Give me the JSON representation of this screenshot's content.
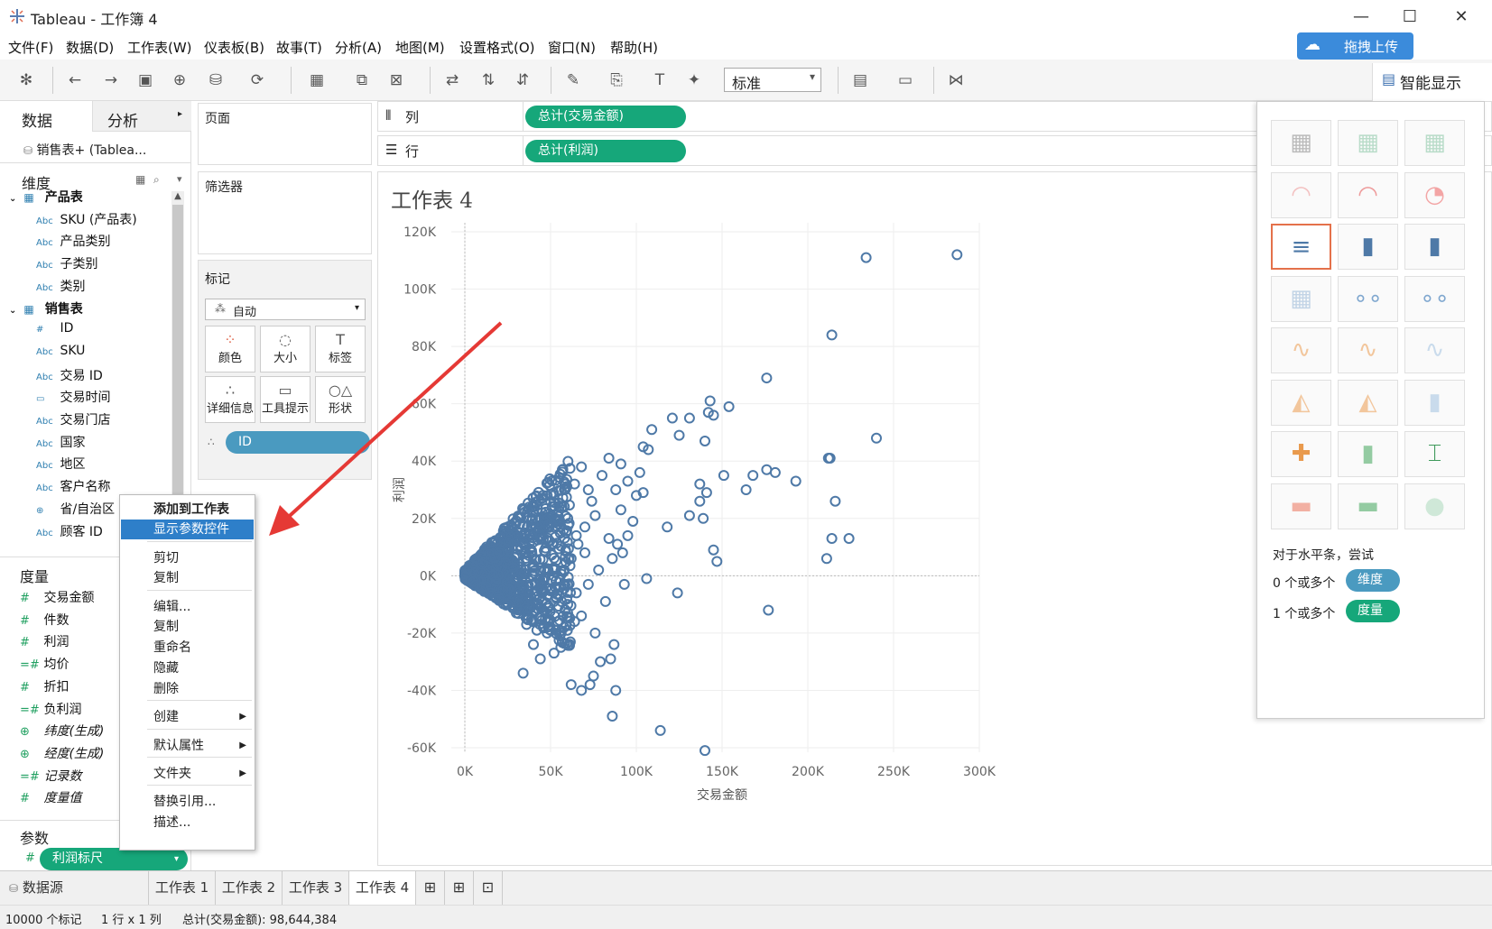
{
  "window": {
    "title": "Tableau - 工作簿 4"
  },
  "menu": [
    "文件(F)",
    "数据(D)",
    "工作表(W)",
    "仪表板(B)",
    "故事(T)",
    "分析(A)",
    "地图(M)",
    "设置格式(O)",
    "窗口(N)",
    "帮助(H)"
  ],
  "upload_button": "拖拽上传",
  "toolbar": {
    "fit_select": "标准",
    "show_me": "智能显示"
  },
  "left_panel": {
    "tabs": [
      "数据",
      "分析"
    ],
    "datasource": "销售表+ (Tablea...",
    "dimensions_header": "维度",
    "tables": [
      {
        "name": "产品表",
        "fields": [
          {
            "type": "Abc",
            "name": "SKU (产品表)"
          },
          {
            "type": "Abc",
            "name": "产品类别"
          },
          {
            "type": "Abc",
            "name": "子类别"
          },
          {
            "type": "Abc",
            "name": "类别"
          }
        ]
      },
      {
        "name": "销售表",
        "fields": [
          {
            "type": "#",
            "name": "ID"
          },
          {
            "type": "Abc",
            "name": "SKU"
          },
          {
            "type": "Abc",
            "name": "交易 ID"
          },
          {
            "type": "date",
            "name": "交易时间"
          },
          {
            "type": "Abc",
            "name": "交易门店"
          },
          {
            "type": "Abc",
            "name": "国家"
          },
          {
            "type": "Abc",
            "name": "地区"
          },
          {
            "type": "Abc",
            "name": "客户名称"
          },
          {
            "type": "geo",
            "name": "省/自治区"
          },
          {
            "type": "Abc",
            "name": "顾客 ID"
          }
        ]
      }
    ],
    "measures_header": "度量",
    "measures": [
      {
        "type": "#",
        "name": "交易金额",
        "italic": false
      },
      {
        "type": "#",
        "name": "件数",
        "italic": false
      },
      {
        "type": "#",
        "name": "利润",
        "italic": false
      },
      {
        "type": "=#",
        "name": "均价",
        "italic": false
      },
      {
        "type": "#",
        "name": "折扣",
        "italic": false
      },
      {
        "type": "=#",
        "name": "负利润",
        "italic": false
      },
      {
        "type": "geo",
        "name": "纬度(生成)",
        "italic": true
      },
      {
        "type": "geo",
        "name": "经度(生成)",
        "italic": true
      },
      {
        "type": "=#",
        "name": "记录数",
        "italic": true
      },
      {
        "type": "#",
        "name": "度量值",
        "italic": true
      }
    ],
    "params_header": "参数",
    "param": "利润标尺"
  },
  "cards": {
    "pages": "页面",
    "filters": "筛选器",
    "marks": "标记",
    "mark_type": "自动",
    "mark_buttons": [
      "颜色",
      "大小",
      "标签",
      "详细信息",
      "工具提示",
      "形状"
    ],
    "detail_pill": "ID"
  },
  "shelves": {
    "columns_label": "列",
    "rows_label": "行",
    "columns_pill": "总计(交易金额)",
    "rows_pill": "总计(利润)"
  },
  "context_menu": {
    "items": [
      {
        "label": "添加到工作表",
        "bold": true,
        "highlight": false,
        "submenu": false
      },
      {
        "label": "显示参数控件",
        "bold": false,
        "highlight": true,
        "submenu": false
      },
      {
        "label": "剪切",
        "bold": false,
        "highlight": false,
        "submenu": false
      },
      {
        "label": "复制",
        "bold": false,
        "highlight": false,
        "submenu": false
      },
      {
        "label": "编辑...",
        "bold": false,
        "highlight": false,
        "submenu": false
      },
      {
        "label": "复制",
        "bold": false,
        "highlight": false,
        "submenu": false
      },
      {
        "label": "重命名",
        "bold": false,
        "highlight": false,
        "submenu": false
      },
      {
        "label": "隐藏",
        "bold": false,
        "highlight": false,
        "submenu": false
      },
      {
        "label": "删除",
        "bold": false,
        "highlight": false,
        "submenu": false
      },
      {
        "label": "创建",
        "bold": false,
        "highlight": false,
        "submenu": true
      },
      {
        "label": "默认属性",
        "bold": false,
        "highlight": false,
        "submenu": true
      },
      {
        "label": "文件夹",
        "bold": false,
        "highlight": false,
        "submenu": true
      },
      {
        "label": "替换引用...",
        "bold": false,
        "highlight": false,
        "submenu": false
      },
      {
        "label": "描述...",
        "bold": false,
        "highlight": false,
        "submenu": false
      }
    ]
  },
  "chart_data": {
    "type": "scatter",
    "title": "工作表 4",
    "xlabel": "交易金额",
    "ylabel": "利润",
    "xlim": [
      0,
      300000
    ],
    "ylim": [
      -60000,
      120000
    ],
    "x_ticks": [
      "0K",
      "50K",
      "100K",
      "150K",
      "200K",
      "250K",
      "300K"
    ],
    "y_ticks": [
      "120K",
      "100K",
      "80K",
      "60K",
      "40K",
      "20K",
      "0K",
      "-20K",
      "-40K",
      "-60K"
    ],
    "marker_color": "#4e79a7",
    "dense_cluster_note_points": "approximate — thousands of overlapping points near origin",
    "points": [
      [
        287000,
        112000
      ],
      [
        234000,
        111000
      ],
      [
        214000,
        84000
      ],
      [
        240000,
        48000
      ],
      [
        176000,
        69000
      ],
      [
        143000,
        61000
      ],
      [
        154000,
        59000
      ],
      [
        142000,
        57000
      ],
      [
        145000,
        56000
      ],
      [
        121000,
        55000
      ],
      [
        131000,
        55000
      ],
      [
        109000,
        51000
      ],
      [
        125000,
        49000
      ],
      [
        140000,
        47000
      ],
      [
        213000,
        41000
      ],
      [
        212000,
        41000
      ],
      [
        176000,
        37000
      ],
      [
        181000,
        36000
      ],
      [
        168000,
        35000
      ],
      [
        193000,
        33000
      ],
      [
        151000,
        35000
      ],
      [
        137000,
        32000
      ],
      [
        141000,
        29000
      ],
      [
        164000,
        30000
      ],
      [
        216000,
        26000
      ],
      [
        137000,
        26000
      ],
      [
        139000,
        20000
      ],
      [
        131000,
        21000
      ],
      [
        224000,
        13000
      ],
      [
        214000,
        13000
      ],
      [
        118000,
        17000
      ],
      [
        145000,
        9000
      ],
      [
        147000,
        5000
      ],
      [
        211000,
        6000
      ],
      [
        177000,
        -12000
      ],
      [
        124000,
        -6000
      ],
      [
        106000,
        -1000
      ],
      [
        93000,
        -3000
      ],
      [
        87000,
        -24000
      ],
      [
        85000,
        -29000
      ],
      [
        79000,
        -30000
      ],
      [
        75000,
        -35000
      ],
      [
        73000,
        -38000
      ],
      [
        62000,
        -38000
      ],
      [
        68000,
        -40000
      ],
      [
        88000,
        -40000
      ],
      [
        86000,
        -49000
      ],
      [
        114000,
        -54000
      ],
      [
        140000,
        -61000
      ],
      [
        34000,
        -34000
      ],
      [
        44000,
        -29000
      ],
      [
        56000,
        -25000
      ],
      [
        98000,
        19000
      ],
      [
        95000,
        14000
      ],
      [
        89000,
        11000
      ],
      [
        84000,
        13000
      ],
      [
        91000,
        23000
      ],
      [
        100000,
        28000
      ],
      [
        104000,
        29000
      ],
      [
        102000,
        36000
      ],
      [
        107000,
        44000
      ],
      [
        104000,
        45000
      ],
      [
        91000,
        39000
      ],
      [
        95000,
        33000
      ],
      [
        88000,
        30000
      ],
      [
        80000,
        35000
      ],
      [
        84000,
        41000
      ],
      [
        74000,
        26000
      ],
      [
        76000,
        21000
      ],
      [
        70000,
        17000
      ],
      [
        66000,
        11000
      ],
      [
        62000,
        6000
      ],
      [
        58000,
        2000
      ],
      [
        55000,
        -4000
      ],
      [
        52000,
        -9000
      ],
      [
        47000,
        -15000
      ],
      [
        42000,
        -19000
      ],
      [
        36000,
        -17000
      ],
      [
        30000,
        -13000
      ],
      [
        25000,
        -10000
      ],
      [
        20000,
        -8000
      ],
      [
        15000,
        -6000
      ],
      [
        10000,
        -4000
      ],
      [
        5000,
        -2000
      ],
      [
        70000,
        8000
      ],
      [
        65000,
        14000
      ],
      [
        60000,
        20000
      ],
      [
        55000,
        24000
      ],
      [
        50000,
        26000
      ],
      [
        45000,
        22000
      ],
      [
        40000,
        18000
      ],
      [
        35000,
        15000
      ],
      [
        30000,
        12000
      ],
      [
        25000,
        10000
      ],
      [
        20000,
        8000
      ],
      [
        15000,
        6000
      ],
      [
        10000,
        4000
      ],
      [
        5000,
        2000
      ],
      [
        60000,
        -10000
      ],
      [
        65000,
        -6000
      ],
      [
        72000,
        -3000
      ],
      [
        78000,
        2000
      ],
      [
        48000,
        -20000
      ],
      [
        58000,
        -18000
      ],
      [
        64000,
        -16000
      ],
      [
        40000,
        -24000
      ],
      [
        52000,
        -27000
      ],
      [
        68000,
        -14000
      ],
      [
        76000,
        -20000
      ],
      [
        82000,
        -9000
      ],
      [
        86000,
        6000
      ],
      [
        92000,
        8000
      ],
      [
        72000,
        30000
      ],
      [
        64000,
        32000
      ],
      [
        68000,
        38000
      ],
      [
        58000,
        30000
      ],
      [
        52000,
        28000
      ]
    ]
  },
  "show_me": {
    "hint": "对于水平条，尝试",
    "dim_text": "0 个或多个",
    "dim_pill": "维度",
    "mea_text": "1 个或多个",
    "mea_pill": "度量"
  },
  "sheet_tabs": {
    "datasource": "数据源",
    "sheets": [
      "工作表 1",
      "工作表 2",
      "工作表 3",
      "工作表 4"
    ],
    "active": 3
  },
  "status": {
    "marks": "10000 个标记",
    "rows_cols": "1 行 x 1 列",
    "sum": "总计(交易金额): 98,644,384"
  },
  "colors": {
    "pill_green": "#16a77a",
    "pill_teal": "#4a9ac0",
    "accent_blue": "#3b8bdb",
    "arrow_red": "#e53935"
  }
}
